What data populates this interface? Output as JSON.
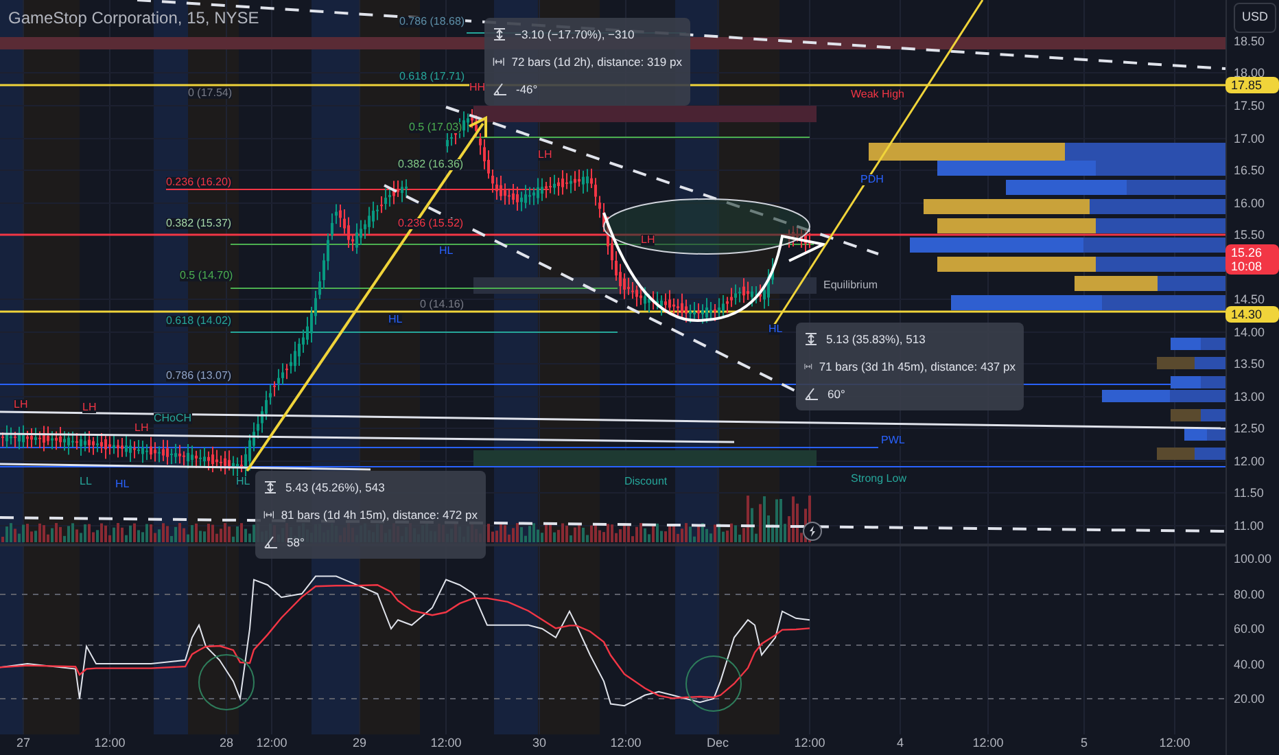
{
  "header": {
    "title": "GameStop Corporation, 15, NYSE"
  },
  "currency_button": "USD",
  "price_axis": [
    "18.50",
    "18.00",
    "17.50",
    "17.00",
    "16.50",
    "16.00",
    "15.50",
    "14.50",
    "14.00",
    "13.50",
    "13.00",
    "12.50",
    "12.00",
    "11.50",
    "11.00"
  ],
  "price_badges": [
    {
      "text": "17.85",
      "kind": "level"
    },
    {
      "text": "14.30",
      "kind": "level"
    }
  ],
  "last_price": {
    "price": "15.26",
    "countdown": "10:08"
  },
  "rsi_axis": [
    "100.00",
    "80.00",
    "60.00",
    "40.00",
    "20.00"
  ],
  "time_axis": [
    "27",
    "12:00",
    "28",
    "12:00",
    "29",
    "12:00",
    "30",
    "12:00",
    "Dec",
    "12:00",
    "4",
    "12:00",
    "5",
    "12:00"
  ],
  "fib_levels": [
    {
      "text": "0.786 (18.68)",
      "color": "#5d8fa8"
    },
    {
      "text": "0.618 (17.71)",
      "color": "#26a69a"
    },
    {
      "text": "0 (17.54)",
      "color": "#787b86"
    },
    {
      "text": "0.5 (17.03)",
      "color": "#4caf50"
    },
    {
      "text": "0.382 (16.36)",
      "color": "#81c784"
    },
    {
      "text": "0.236 (16.20)",
      "color": "#f23645"
    },
    {
      "text": "0.382 (15.37)",
      "color": "#a5d6a7"
    },
    {
      "text": "0.236 (15.52)",
      "color": "#f23645"
    },
    {
      "text": "0.5 (14.70)",
      "color": "#4caf50"
    },
    {
      "text": "0 (14.16)",
      "color": "#787b86"
    },
    {
      "text": "0.618 (14.02)",
      "color": "#26a69a"
    },
    {
      "text": "0.786 (13.07)",
      "color": "#8fa3c8"
    }
  ],
  "markers": [
    {
      "text": "HH",
      "color": "#f23645"
    },
    {
      "text": "Weak High",
      "color": "#f23645"
    },
    {
      "text": "LH",
      "color": "#f23645"
    },
    {
      "text": "PDH",
      "color": "#2962ff"
    },
    {
      "text": "LH",
      "color": "#f23645"
    },
    {
      "text": "HL",
      "color": "#2962ff"
    },
    {
      "text": "Equilibrium",
      "color": "#b2b5be"
    },
    {
      "text": "HL",
      "color": "#2962ff"
    },
    {
      "text": "HL",
      "color": "#2962ff"
    },
    {
      "text": "LH",
      "color": "#f23645"
    },
    {
      "text": "LH",
      "color": "#f23645"
    },
    {
      "text": "CHoCH",
      "color": "#26a69a"
    },
    {
      "text": "LH",
      "color": "#f23645"
    },
    {
      "text": "PWL",
      "color": "#2962ff"
    },
    {
      "text": "LL",
      "color": "#26a69a"
    },
    {
      "text": "HL",
      "color": "#2962ff"
    },
    {
      "text": "HL",
      "color": "#26a69a"
    },
    {
      "text": "Discount",
      "color": "#26a69a"
    },
    {
      "text": "Strong Low",
      "color": "#26a69a"
    }
  ],
  "measure_boxes": [
    {
      "price": "−3.10 (−17.70%), −310",
      "bars": "72 bars (1d 2h), distance: 319 px",
      "angle": "-46°"
    },
    {
      "price": "5.13 (35.83%), 513",
      "bars": "71 bars (3d 1h 45m), distance: 437 px",
      "angle": "60°"
    },
    {
      "price": "5.43 (45.26%), 543",
      "bars": "81 bars (1d 4h 15m), distance: 472 px",
      "angle": "58°"
    }
  ]
}
